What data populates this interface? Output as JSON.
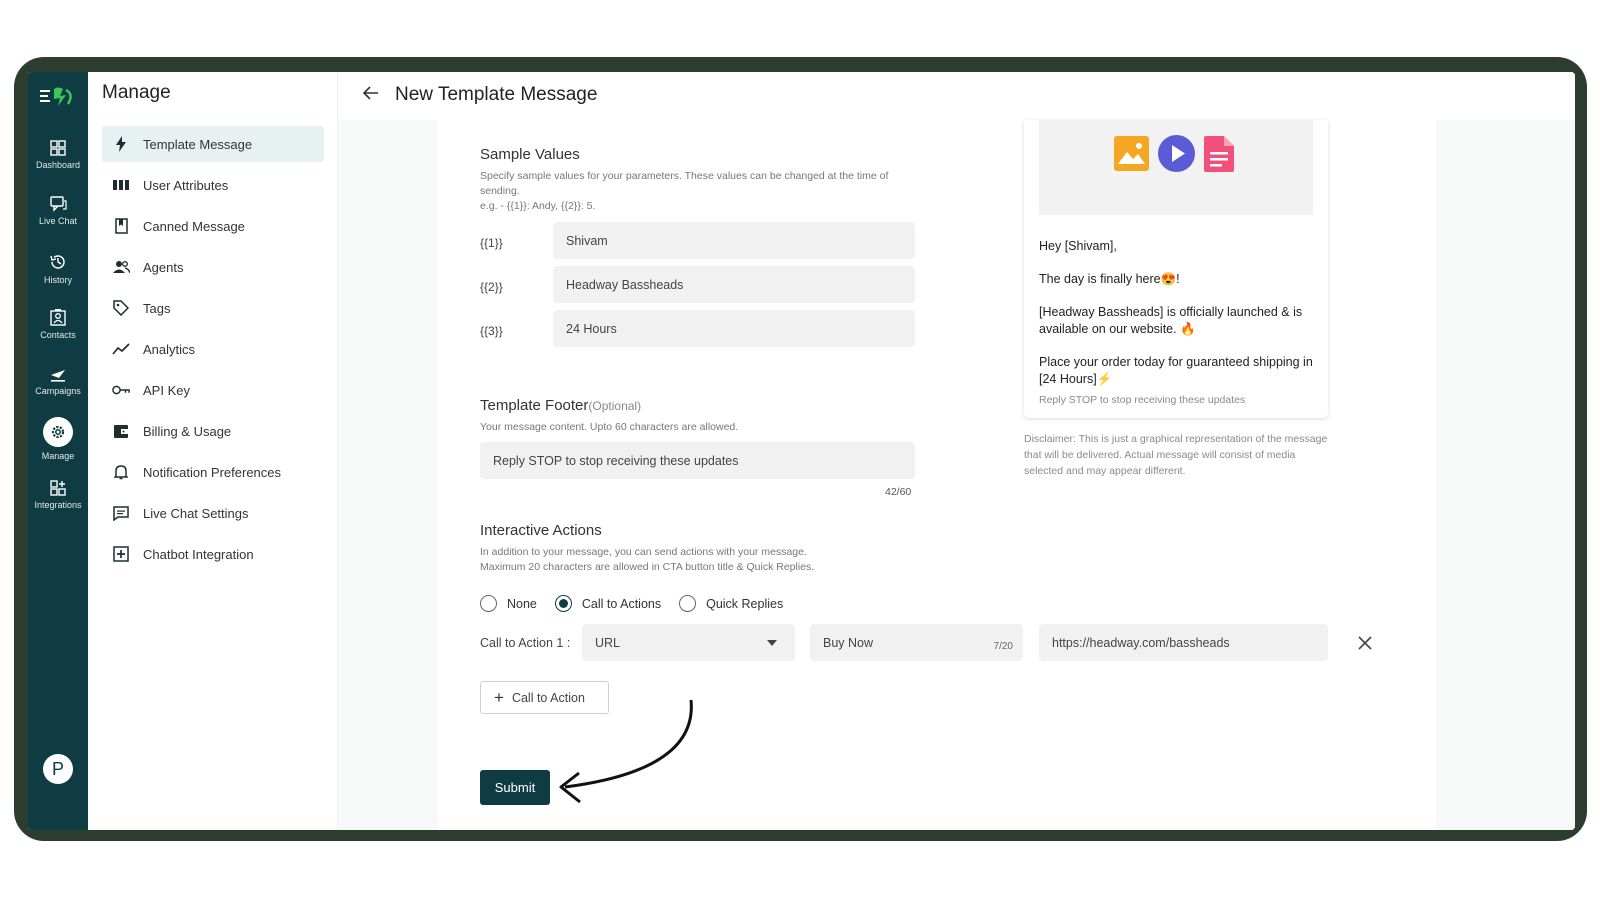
{
  "rail": {
    "items": [
      {
        "label": "Dashboard",
        "icon": "dashboard-icon"
      },
      {
        "label": "Live Chat",
        "icon": "live-chat-icon"
      },
      {
        "label": "History",
        "icon": "history-icon"
      },
      {
        "label": "Contacts",
        "icon": "contacts-icon"
      },
      {
        "label": "Campaigns",
        "icon": "campaigns-icon"
      },
      {
        "label": "Manage",
        "icon": "gear-icon"
      },
      {
        "label": "Integrations",
        "icon": "integrations-icon"
      }
    ],
    "avatar_initial": "P"
  },
  "sidebar": {
    "title": "Manage",
    "items": [
      {
        "label": "Template Message",
        "icon": "lightning-icon",
        "active": true
      },
      {
        "label": "User Attributes",
        "icon": "columns-icon"
      },
      {
        "label": "Canned Message",
        "icon": "bookmark-icon"
      },
      {
        "label": "Agents",
        "icon": "agents-icon"
      },
      {
        "label": "Tags",
        "icon": "tag-icon"
      },
      {
        "label": "Analytics",
        "icon": "analytics-icon"
      },
      {
        "label": "API Key",
        "icon": "key-icon"
      },
      {
        "label": "Billing & Usage",
        "icon": "wallet-icon"
      },
      {
        "label": "Notification Preferences",
        "icon": "bell-icon"
      },
      {
        "label": "Live Chat Settings",
        "icon": "chat-settings-icon"
      },
      {
        "label": "Chatbot Integration",
        "icon": "chatbot-icon"
      }
    ]
  },
  "header": {
    "title": "New Template Message"
  },
  "sample_values": {
    "title": "Sample Values",
    "helper_line1": "Specify sample values for your parameters. These values can be changed at the time of",
    "helper_line2": "sending.",
    "helper_line3": "e.g. - {{1}}: Andy, {{2}}: 5.",
    "params": [
      {
        "label": "{{1}}",
        "value": "Shivam"
      },
      {
        "label": "{{2}}",
        "value": "Headway Bassheads"
      },
      {
        "label": "{{3}}",
        "value": "24 Hours"
      }
    ]
  },
  "footer_section": {
    "title": "Template Footer",
    "optional": "(Optional)",
    "helper": "Your message content. Upto 60 characters are allowed.",
    "value": "Reply STOP to stop receiving these updates",
    "counter": "42/60"
  },
  "interactive": {
    "title": "Interactive Actions",
    "helper_line1": "In addition to your message, you can send actions with your message.",
    "helper_line2": "Maximum 20 characters are allowed in CTA button title & Quick Replies.",
    "options": [
      "None",
      "Call to Actions",
      "Quick Replies"
    ],
    "selected": "Call to Actions",
    "cta_label": "Call to Action 1 :",
    "cta_type": "URL",
    "cta_title": "Buy Now",
    "cta_title_counter": "7/20",
    "cta_url": "https://headway.com/bassheads",
    "add_cta_label": "Call to Action",
    "submit_label": "Submit"
  },
  "preview": {
    "greeting": "Hey [Shivam],",
    "line1": "The day is finally here😍!",
    "line2": "[Headway Bassheads] is officially launched & is available on our website. 🔥",
    "line3": "Place your order today for guaranteed shipping in [24 Hours]⚡",
    "footer": "Reply STOP to stop receiving these updates",
    "disclaimer": "Disclaimer: This is just a graphical representation of the message that will be delivered. Actual message will consist of media selected and may appear different."
  },
  "colors": {
    "rail_bg": "#0f3c43",
    "accent": "#0f3c43",
    "frame": "#2c3d30",
    "launcher": "#25b34a",
    "image_icon": "#f5a623",
    "video_icon": "#5b5bd6",
    "document_icon": "#f0507a"
  }
}
